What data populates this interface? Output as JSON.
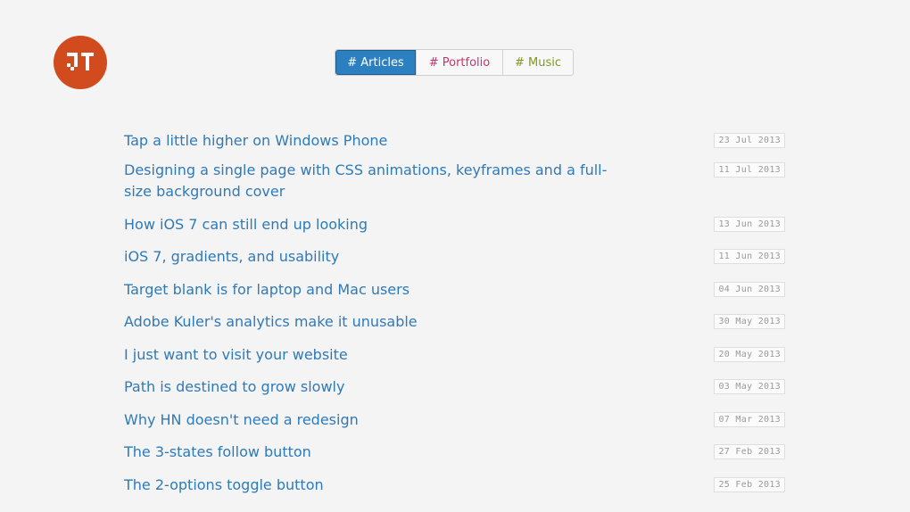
{
  "colors": {
    "logo_bg": "#d14b1f",
    "link": "#2f7ab8",
    "tab_active_bg": "#2d80c0",
    "tab_portfolio": "#c2366e",
    "tab_music": "#7e9a1c",
    "page_bg": "#f4f4f4"
  },
  "logo": {
    "icon": "jt-monogram-icon"
  },
  "tabs": [
    {
      "label": "# Articles",
      "active": true
    },
    {
      "label": "# Portfolio",
      "active": false
    },
    {
      "label": "# Music",
      "active": false
    }
  ],
  "articles": [
    {
      "title": "Tap a little higher on Windows Phone",
      "date": "23 Jul 2013"
    },
    {
      "title": "Designing a single page with CSS animations, keyframes and a full-size background cover",
      "date": "11 Jul 2013"
    },
    {
      "title": "How iOS 7 can still end up looking",
      "date": "13 Jun 2013"
    },
    {
      "title": "iOS 7, gradients, and usability",
      "date": "11 Jun 2013"
    },
    {
      "title": "Target blank is for laptop and Mac users",
      "date": "04 Jun 2013"
    },
    {
      "title": "Adobe Kuler's analytics make it unusable",
      "date": "30 May 2013"
    },
    {
      "title": "I just want to visit your website",
      "date": "20 May 2013"
    },
    {
      "title": "Path is destined to grow slowly",
      "date": "03 May 2013"
    },
    {
      "title": "Why HN doesn't need a redesign",
      "date": "07 Mar 2013"
    },
    {
      "title": "The 3-states follow button",
      "date": "27 Feb 2013"
    },
    {
      "title": "The 2-options toggle button",
      "date": "25 Feb 2013"
    }
  ]
}
